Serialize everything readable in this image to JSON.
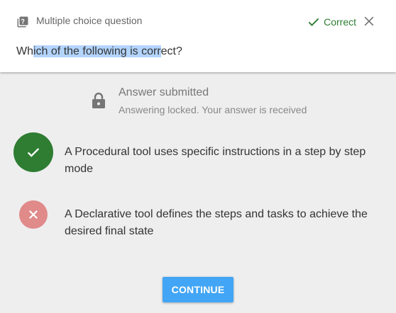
{
  "header": {
    "question_type": "Multiple choice question",
    "status_label": "Correct",
    "status_color": "#2e7d32",
    "icons": {
      "question_type": "quiz-icon",
      "status": "check-icon",
      "close": "close-icon"
    }
  },
  "question": {
    "text_before": "Wh",
    "text_selected": "ich of the following is corr",
    "text_after": "ect?"
  },
  "submission": {
    "title": "Answer submitted",
    "subtitle": "Answering locked. Your answer is received",
    "icon": "lock-icon"
  },
  "answers": [
    {
      "text": "A Procedural tool uses specific instructions in a step by step mode",
      "state": "correct",
      "color": "#2e7d32"
    },
    {
      "text": "A Declarative tool defines the steps and tasks to achieve the desired final state",
      "state": "incorrect",
      "color": "#e08a8a"
    }
  ],
  "actions": {
    "continue_label": "CONTINUE",
    "continue_color": "#42a5f5"
  }
}
